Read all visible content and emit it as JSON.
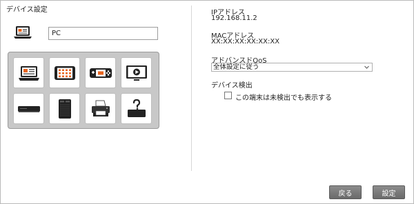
{
  "section": {
    "title": "デバイス設定"
  },
  "device": {
    "name_value": "PC"
  },
  "device_types": [
    {
      "icon": "laptop-icon"
    },
    {
      "icon": "tablet-icon"
    },
    {
      "icon": "gamepad-icon"
    },
    {
      "icon": "tv-icon"
    },
    {
      "icon": "media-player-icon"
    },
    {
      "icon": "nas-icon"
    },
    {
      "icon": "printer-icon"
    },
    {
      "icon": "unknown-device-icon"
    }
  ],
  "info": {
    "ip_label": "IPアドレス",
    "ip_value": "192.168.11.2",
    "mac_label": "MACアドレス",
    "mac_value": "XX:XX:XX:XX:XX:XX",
    "qos_label": "アドバンスドQoS",
    "qos_selected": "全体設定に従う",
    "detect_label": "デバイス検出",
    "detect_checkbox_label": "この端末は未検出でも表示する",
    "detect_checked": false
  },
  "buttons": {
    "back": "戻る",
    "save": "設定"
  }
}
